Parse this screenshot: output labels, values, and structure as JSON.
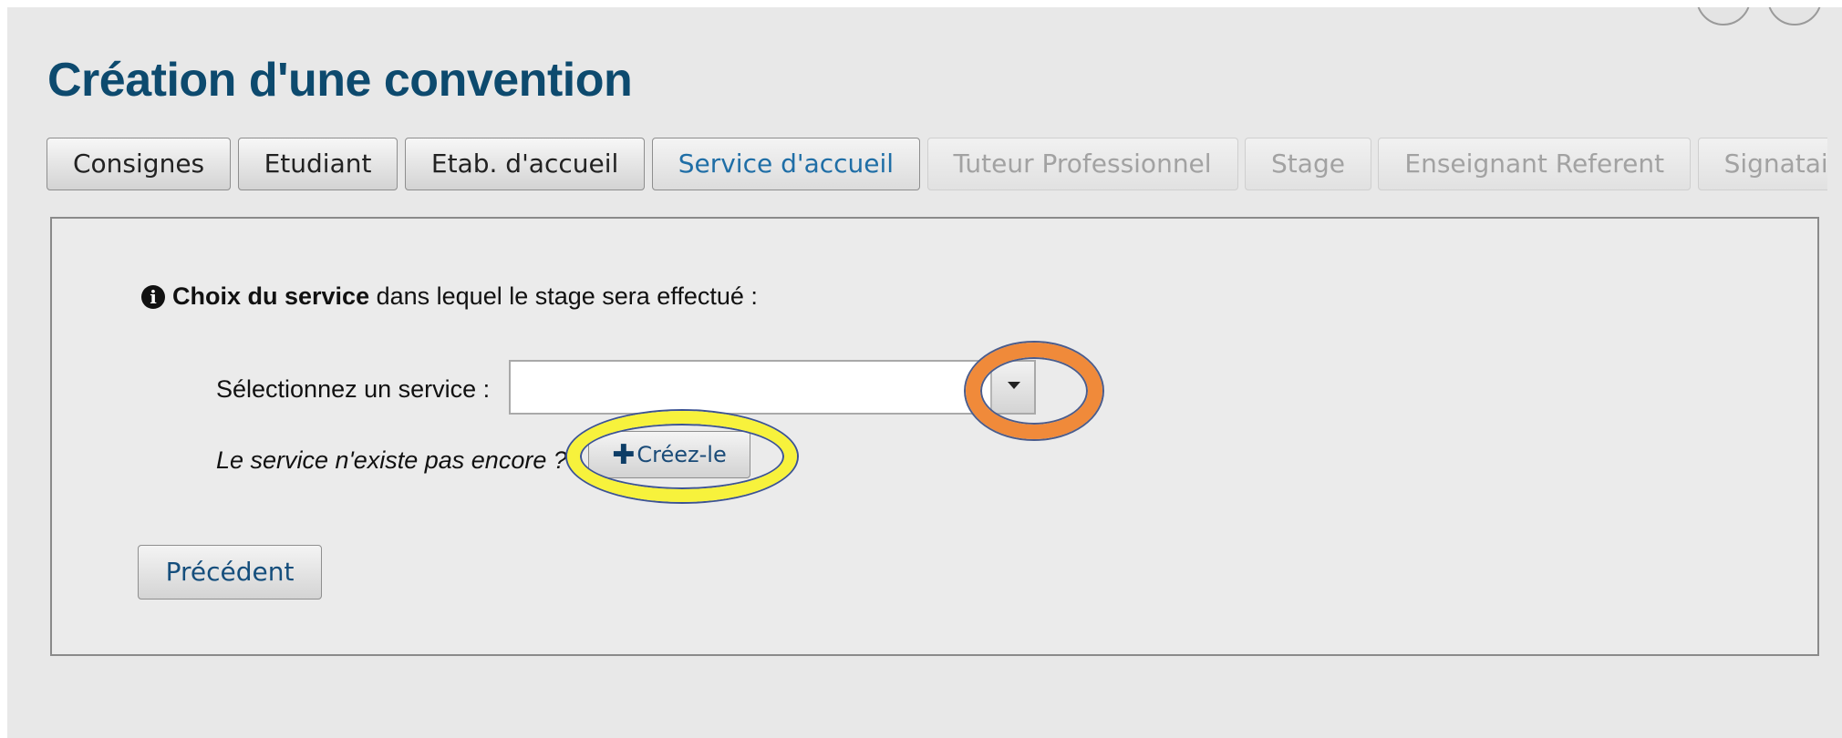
{
  "page": {
    "title": "Création d'une convention"
  },
  "tabs": [
    {
      "label": "Consignes",
      "state": "done"
    },
    {
      "label": "Etudiant",
      "state": "done"
    },
    {
      "label": "Etab. d'accueil",
      "state": "done"
    },
    {
      "label": "Service d'accueil",
      "state": "active"
    },
    {
      "label": "Tuteur Professionnel",
      "state": "disabled"
    },
    {
      "label": "Stage",
      "state": "disabled"
    },
    {
      "label": "Enseignant Referent",
      "state": "disabled"
    },
    {
      "label": "Signataire",
      "state": "disabled"
    }
  ],
  "panel": {
    "info_icon": "info-circle-icon",
    "info_bold": "Choix du service",
    "info_rest": " dans lequel le stage sera effectué :",
    "select_label": "Sélectionnez un service :",
    "select_value": "",
    "create_prompt": "Le service n'existe pas encore ?",
    "create_icon": "plus-icon",
    "create_button": "Créez-le",
    "previous_button": "Précédent"
  },
  "annotations": {
    "dropdown_highlight_color": "#f08a3a",
    "create_highlight_color": "#f7f23c"
  },
  "colors": {
    "title": "#0d4a6e",
    "active_tab_text": "#1f6ea6",
    "disabled_tab_text": "#a2a2a2",
    "button_text": "#154e7c"
  }
}
